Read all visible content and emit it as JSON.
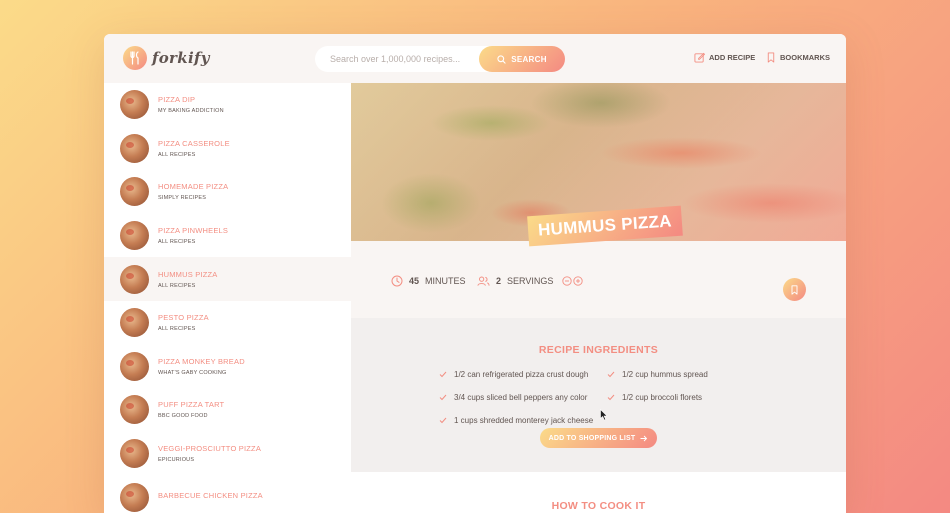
{
  "header": {
    "logo_text": "forkify",
    "search_placeholder": "Search over 1,000,000 recipes...",
    "search_button": "SEARCH",
    "add_recipe": "ADD RECIPE",
    "bookmarks": "BOOKMARKS"
  },
  "results": [
    {
      "title": "PIZZA DIP",
      "publisher": "MY BAKING ADDICTION"
    },
    {
      "title": "PIZZA CASSEROLE",
      "publisher": "ALL RECIPES"
    },
    {
      "title": "HOMEMADE PIZZA",
      "publisher": "SIMPLY RECIPES"
    },
    {
      "title": "PIZZA PINWHEELS",
      "publisher": "ALL RECIPES"
    },
    {
      "title": "HUMMUS PIZZA",
      "publisher": "ALL RECIPES",
      "active": true
    },
    {
      "title": "PESTO PIZZA",
      "publisher": "ALL RECIPES"
    },
    {
      "title": "PIZZA MONKEY BREAD",
      "publisher": "WHAT'S GABY COOKING"
    },
    {
      "title": "PUFF PIZZA TART",
      "publisher": "BBC GOOD FOOD"
    },
    {
      "title": "VEGGI-PROSCIUTTO PIZZA",
      "publisher": "EPICURIOUS"
    },
    {
      "title": "BARBECUE CHICKEN PIZZA",
      "publisher": ""
    }
  ],
  "recipe": {
    "title": "HUMMUS PIZZA",
    "minutes_value": "45",
    "minutes_label": "MINUTES",
    "servings_value": "2",
    "servings_label": "SERVINGS",
    "ingredients_heading": "RECIPE INGREDIENTS",
    "ingredients": [
      "1/2 can refrigerated pizza crust dough",
      "1/2 cup hummus spread",
      "3/4 cups sliced bell peppers any color",
      "1/2 cup broccoli florets",
      "1 cups shredded monterey jack cheese"
    ],
    "shopping_button": "ADD TO SHOPPING LIST",
    "directions_heading": "HOW TO COOK IT"
  },
  "colors": {
    "accent": "#f38e82",
    "gradient_start": "#fbdb89",
    "gradient_end": "#f48982",
    "text": "#615551"
  }
}
